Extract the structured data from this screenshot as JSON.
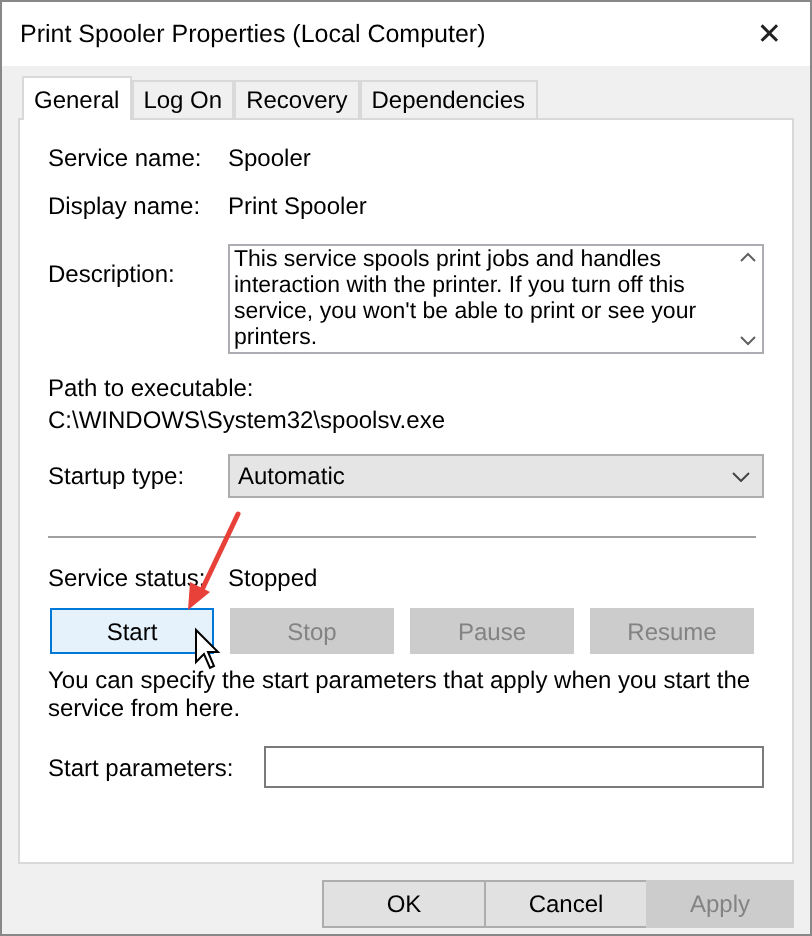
{
  "window": {
    "title": "Print Spooler Properties (Local Computer)",
    "close": "✕"
  },
  "tabs": [
    {
      "label": "General",
      "selected": true
    },
    {
      "label": "Log On",
      "selected": false
    },
    {
      "label": "Recovery",
      "selected": false
    },
    {
      "label": "Dependencies",
      "selected": false
    }
  ],
  "fields": [
    {
      "label": "Service name:",
      "value": "Spooler"
    },
    {
      "label": "Display name:",
      "value": "Print Spooler"
    }
  ],
  "description": {
    "label": "Description:",
    "value": "This service spools print jobs and handles interaction with the printer.  If you turn off this service, you won't be able to print or see your printers."
  },
  "path": {
    "label": "Path to executable:",
    "value": "C:\\WINDOWS\\System32\\spoolsv.exe"
  },
  "startup_type": {
    "label": "Startup type:",
    "value": "Automatic"
  },
  "service_status": {
    "label": "Service status:",
    "value": "Stopped"
  },
  "service_buttons": [
    {
      "label": "Start",
      "disabled": false,
      "hovered": true
    },
    {
      "label": "Stop",
      "disabled": true,
      "hovered": false
    },
    {
      "label": "Pause",
      "disabled": true,
      "hovered": false
    },
    {
      "label": "Resume",
      "disabled": true,
      "hovered": false
    }
  ],
  "hint": "You can specify the start parameters that apply when you start the service from here.",
  "start_parameters": {
    "label": "Start parameters:"
  },
  "dialog_buttons": [
    {
      "label": "OK",
      "disabled": false
    },
    {
      "label": "Cancel",
      "disabled": false
    },
    {
      "label": "Apply",
      "disabled": true
    }
  ]
}
